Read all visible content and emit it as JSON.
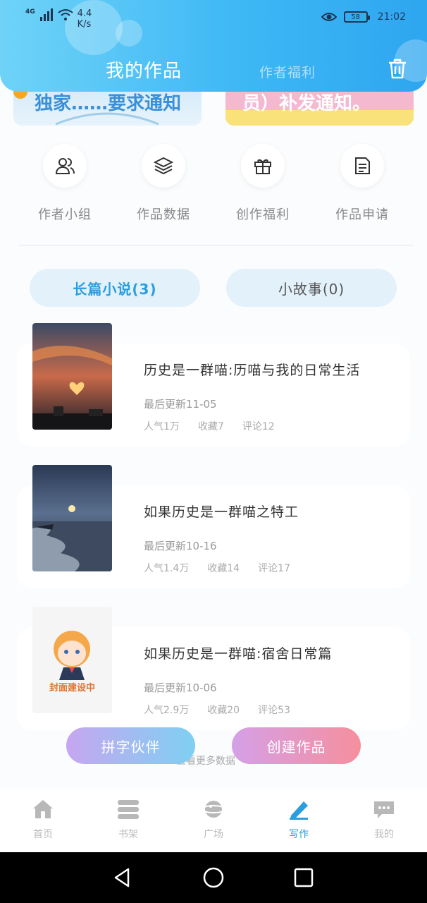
{
  "status_bar": {
    "network": "4G",
    "speed_value": "4.4",
    "speed_unit": "K/s",
    "battery": "58",
    "time": "21:02"
  },
  "header": {
    "tab_active": "我的作品",
    "tab_inactive": "作者福利"
  },
  "banners": [
    "独家……要求通知",
    "员）补发通知。"
  ],
  "quick_actions": [
    {
      "label": "作者小组",
      "icon": "users-icon"
    },
    {
      "label": "作品数据",
      "icon": "layers-icon"
    },
    {
      "label": "创作福利",
      "icon": "gift-icon"
    },
    {
      "label": "作品申请",
      "icon": "document-icon"
    }
  ],
  "segments": {
    "novel": "长篇小说(3)",
    "story": "小故事(0)"
  },
  "works": [
    {
      "title": "历史是一群喵:历喵与我的日常生活",
      "updated": "最后更新11-05",
      "popularity": "人气1万",
      "favorites": "收藏7",
      "comments": "评论12"
    },
    {
      "title": "如果历史是一群喵之特工",
      "updated": "最后更新10-16",
      "popularity": "人气1.4万",
      "favorites": "收藏14",
      "comments": "评论17"
    },
    {
      "title": "如果历史是一群喵:宿舍日常篇",
      "updated": "最后更新10-06",
      "popularity": "人气2.9万",
      "favorites": "收藏20",
      "comments": "评论53",
      "cover_text": "封面建设中"
    }
  ],
  "floating": {
    "partner": "拼字伙伴",
    "create": "创建作品",
    "more": "查看更多数据"
  },
  "tabbar": [
    {
      "label": "首页",
      "icon": "home-icon"
    },
    {
      "label": "书架",
      "icon": "bookshelf-icon"
    },
    {
      "label": "广场",
      "icon": "planet-icon"
    },
    {
      "label": "写作",
      "icon": "pen-icon",
      "active": true
    },
    {
      "label": "我的",
      "icon": "chat-icon"
    }
  ],
  "colors": {
    "accent": "#2b9ee0",
    "header": "#3fb8f5"
  }
}
